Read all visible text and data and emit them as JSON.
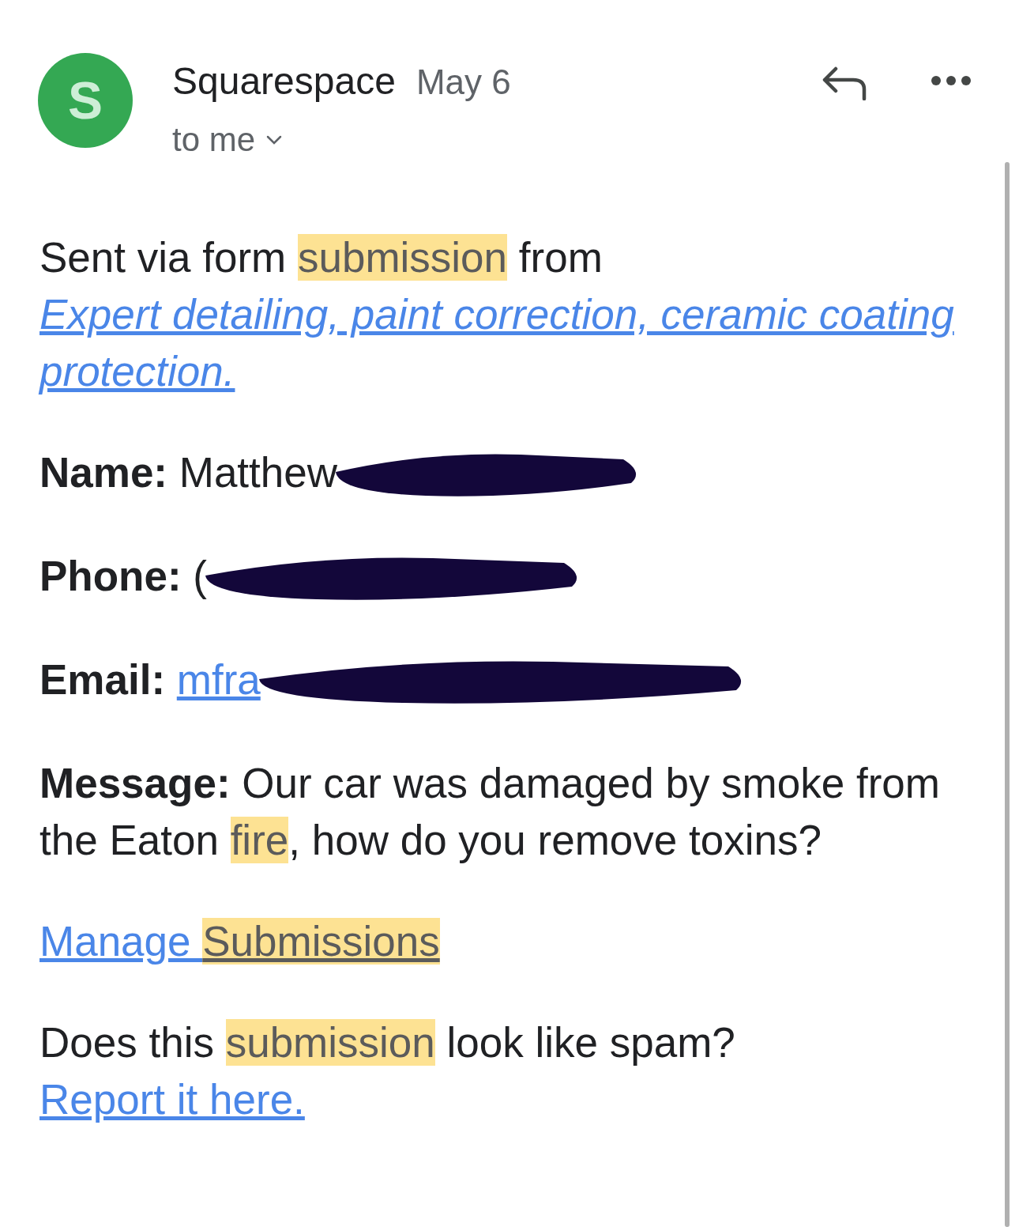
{
  "header": {
    "avatar_letter": "S",
    "sender": "Squarespace",
    "date": "May 6",
    "recipient": "to me"
  },
  "paragraphs": [
    {
      "parts": [
        {
          "kind": "plain",
          "text": "Sent via form ",
          "highlighted": false,
          "italic": false
        },
        {
          "kind": "plain",
          "text": "submission",
          "highlighted": true,
          "italic": false
        },
        {
          "kind": "plain",
          "text": " from ",
          "highlighted": false,
          "italic": false
        },
        {
          "kind": "link",
          "text": "Expert detailing, paint correction, ceramic coating protection.",
          "highlighted": false,
          "italic": true
        }
      ]
    },
    {
      "parts": [
        {
          "kind": "bold",
          "text": "Name: ",
          "highlighted": false,
          "italic": false
        },
        {
          "kind": "plain",
          "text": "Matthew",
          "highlighted": false,
          "italic": false
        },
        {
          "kind": "redaction"
        }
      ]
    },
    {
      "parts": [
        {
          "kind": "bold",
          "text": "Phone: ",
          "highlighted": false,
          "italic": false
        },
        {
          "kind": "plain",
          "text": "(",
          "highlighted": false,
          "italic": false
        },
        {
          "kind": "redaction"
        }
      ]
    },
    {
      "parts": [
        {
          "kind": "bold",
          "text": "Email: ",
          "highlighted": false,
          "italic": false
        },
        {
          "kind": "link",
          "text": "mfra",
          "highlighted": false,
          "italic": false
        },
        {
          "kind": "redaction"
        }
      ]
    },
    {
      "parts": [
        {
          "kind": "bold",
          "text": "Message: ",
          "highlighted": false,
          "italic": false
        },
        {
          "kind": "plain",
          "text": "Our car was damaged by smoke from the Eaton ",
          "highlighted": false,
          "italic": false
        },
        {
          "kind": "plain",
          "text": "fire",
          "highlighted": true,
          "italic": false
        },
        {
          "kind": "plain",
          "text": ", how do you remove toxins?",
          "highlighted": false,
          "italic": false
        }
      ]
    },
    {
      "parts": [
        {
          "kind": "link",
          "text": "Manage ",
          "highlighted": false,
          "italic": false
        },
        {
          "kind": "link",
          "text": "Submissions",
          "highlighted": true,
          "italic": false
        }
      ]
    },
    {
      "parts": [
        {
          "kind": "plain",
          "text": "Does this ",
          "highlighted": false,
          "italic": false
        },
        {
          "kind": "plain",
          "text": "submission",
          "highlighted": true,
          "italic": false
        },
        {
          "kind": "plain",
          "text": " look like spam? ",
          "highlighted": false,
          "italic": false
        },
        {
          "kind": "link",
          "text": "Report it here.",
          "highlighted": false,
          "italic": false
        }
      ]
    }
  ]
}
